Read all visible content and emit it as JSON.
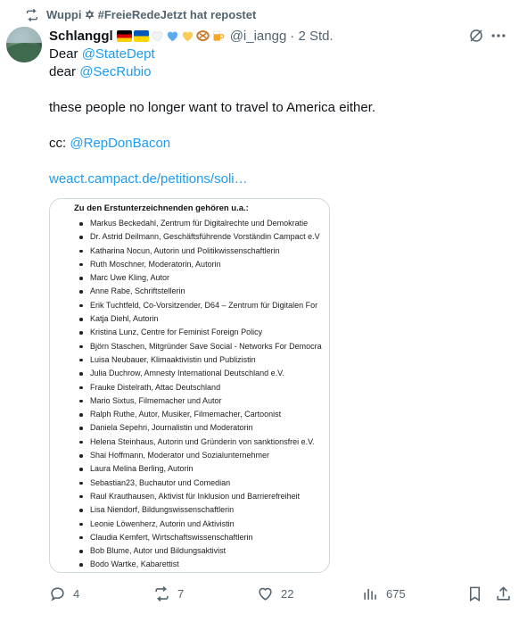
{
  "repost": {
    "icon": "repost-icon",
    "text": "Wuppi ✡ #FreieRedeJetzt hat repostet"
  },
  "author": {
    "name": "Schlanggl",
    "emojis": [
      "flag-de-icon",
      "flag-ua-icon",
      "white-heart-icon",
      "blue-heart-icon",
      "yellow-heart-icon",
      "pretzel-icon",
      "beer-icon"
    ],
    "handle": "@i_iangg",
    "time": "· 2 Std."
  },
  "tweet": {
    "line1_prefix": "Dear ",
    "line1_mention": "@StateDept",
    "line2_prefix": "dear ",
    "line2_mention": "@SecRubio",
    "line3": "these people no longer want to travel to America either.",
    "line4_prefix": "cc: ",
    "line4_mention": "@RepDonBacon",
    "link": "weact.campact.de/petitions/soli…"
  },
  "document": {
    "title": "Zu den Erstunterzeichnenden gehören u.a.:",
    "items": [
      "Markus Beckedahl, Zentrum für Digitalrechte und Demokratie",
      "Dr. Astrid Deilmann, Geschäftsführende Vorständin Campact e.V",
      "Katharina Nocun, Autorin und Politikwissenschaftlerin",
      "Ruth Moschner, Moderatorin, Autorin",
      "Marc Uwe Kling, Autor",
      "Anne Rabe, Schriftstellerin",
      "Erik Tuchtfeld, Co-Vorsitzender, D64 – Zentrum für Digitalen For",
      "Katja Diehl, Autorin",
      "Kristina Lunz, Centre for Feminist Foreign Policy",
      "Björn Staschen, Mitgründer Save Social - Networks For Democra",
      "Luisa Neubauer, Klimaaktivistin und Publizistin",
      "Julia Duchrow, Amnesty International Deutschland e.V.",
      "Frauke Distelrath, Attac Deutschland",
      "Mario Sixtus, Filmemacher und Autor",
      "Ralph Ruthe, Autor, Musiker, Filmemacher, Cartoonist",
      "Daniela Sepehri, Journalistin und Moderatorin",
      "Helena Steinhaus, Autorin und Gründerin von sanktionsfrei e.V.",
      "Shai Hoffmann, Moderator und Sozialunternehmer",
      "Laura Melina Berling, Autorin",
      "Sebastian23, Buchautor und Comedian",
      "Raul Krauthausen, Aktivist für Inklusion und Barrierefreiheit",
      "Lisa Niendorf, Bildungswissenschaftlerin",
      "Leonie Löwenherz, Autorin und Aktivistin",
      "Claudia Kemfert, Wirtschaftswissenschaftlerin",
      "Bob Blume, Autor und Bildungsaktivist",
      "Bodo Wartke, Kabarettist"
    ]
  },
  "actions": {
    "reply_count": "4",
    "repost_count": "7",
    "like_count": "22",
    "views_count": "675"
  }
}
